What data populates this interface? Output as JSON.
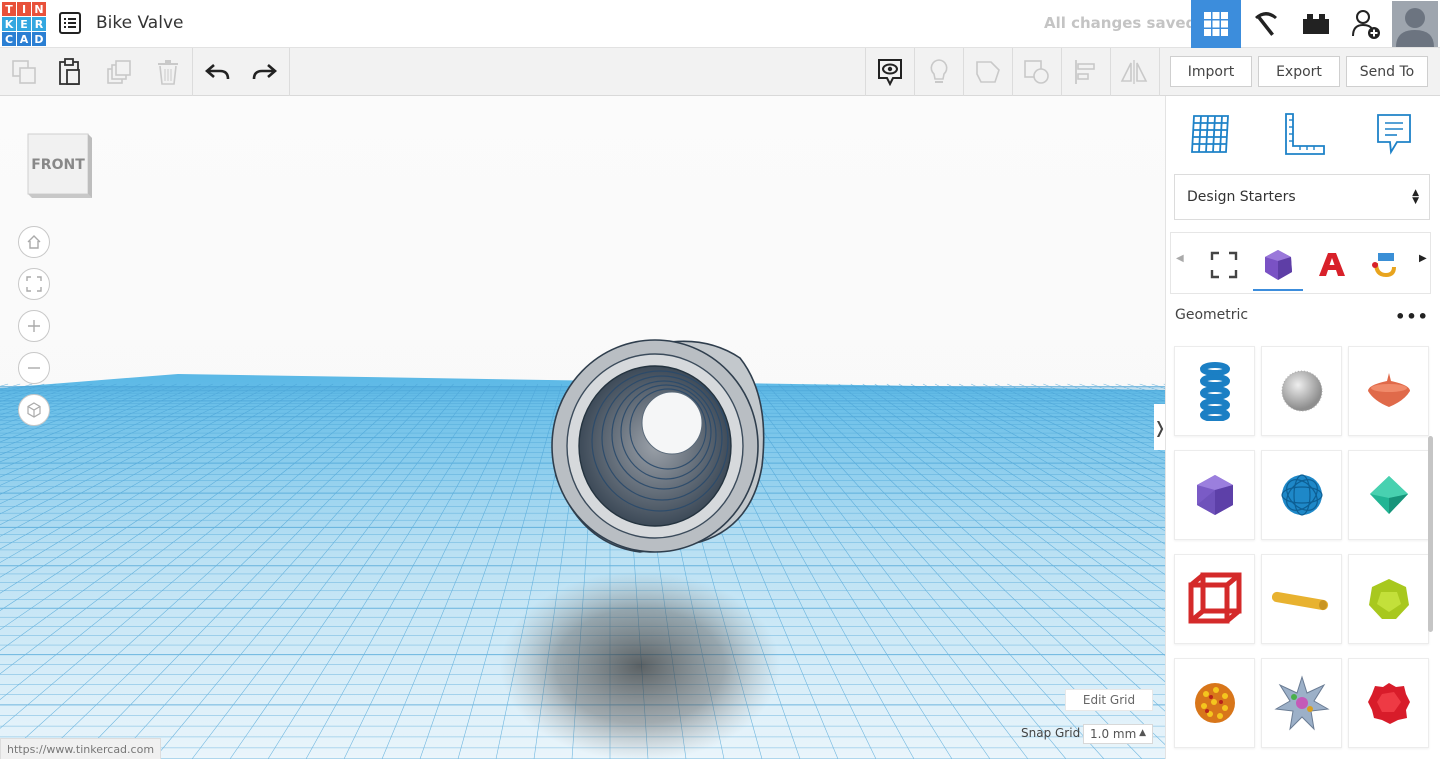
{
  "app": {
    "logo_letters": [
      "T",
      "I",
      "N",
      "K",
      "E",
      "R",
      "C",
      "A",
      "D"
    ],
    "logo_colors": [
      "#e8513a",
      "#e8513a",
      "#e8513a",
      "#33a7e0",
      "#33a7e0",
      "#33a7e0",
      "#2b7fd3",
      "#2b7fd3",
      "#2b7fd3"
    ],
    "design_title": "Bike Valve",
    "save_status": "All changes saved",
    "accent_color": "#3c8ddc"
  },
  "top_actions": [
    {
      "name": "3d-design-view-icon",
      "active": true
    },
    {
      "name": "blocks-pickaxe-icon",
      "active": false
    },
    {
      "name": "bricks-icon",
      "active": false
    },
    {
      "name": "invite-user-icon",
      "active": false
    }
  ],
  "toolbar": {
    "left_tools": [
      "copy-icon",
      "paste-icon",
      "duplicate-icon",
      "delete-icon",
      "undo-icon",
      "redo-icon"
    ],
    "right_tools": [
      "show-notes-icon",
      "lightbulb-icon",
      "group-icon",
      "ungroup-icon",
      "align-icon",
      "mirror-icon"
    ],
    "import_label": "Import",
    "export_label": "Export",
    "send_to_label": "Send To"
  },
  "viewport": {
    "viewcube_label": "FRONT",
    "nav": [
      "home-view-icon",
      "fit-view-icon",
      "zoom-in-icon",
      "zoom-out-icon",
      "perspective-icon"
    ],
    "edit_grid_label": "Edit Grid",
    "snap_grid_label": "Snap Grid",
    "snap_grid_value": "1.0 mm",
    "status_url": "https://www.tinkercad.com",
    "collapse_glyph": "❭"
  },
  "panel": {
    "top_icons": [
      "workplane-icon",
      "ruler-icon",
      "notes-icon"
    ],
    "library_dropdown": "Design Starters",
    "categories": [
      "favorites-icon",
      "geometric-icon",
      "text-icon",
      "connectors-icon"
    ],
    "section_title": "Geometric",
    "more_label": "•••",
    "shapes": [
      {
        "name": "spring-shape",
        "color": "#1b7fc4"
      },
      {
        "name": "sphere-noise-shape",
        "color": "#b5b5b5"
      },
      {
        "name": "spinning-top-shape",
        "color": "#e06a4a"
      },
      {
        "name": "icosahedron-shape",
        "color": "#7a5bc6"
      },
      {
        "name": "ball-of-yarn-shape",
        "color": "#1e88c8"
      },
      {
        "name": "octahedron-shape",
        "color": "#22b594"
      },
      {
        "name": "cube-frame-shape",
        "color": "#d42a2a"
      },
      {
        "name": "rod-shape",
        "color": "#e8b230"
      },
      {
        "name": "dodecahedron-shape",
        "color": "#a8c81e"
      },
      {
        "name": "dotted-sphere-shape",
        "color": "#d8761a"
      },
      {
        "name": "star-polyhedron-shape",
        "color": "#8a9ab8"
      },
      {
        "name": "rough-sphere-shape",
        "color": "#d81c2a"
      }
    ]
  }
}
